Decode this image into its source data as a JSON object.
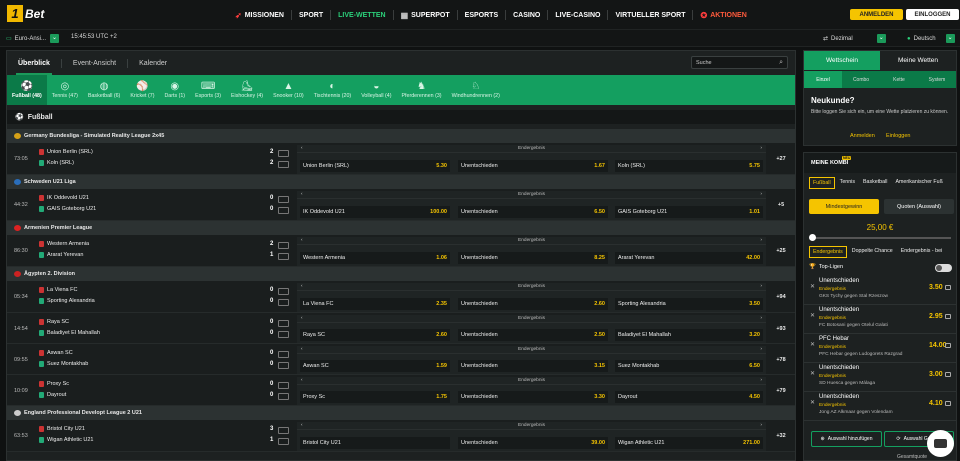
{
  "brand": {
    "one": "1",
    "bet": "Bet"
  },
  "nav": [
    {
      "label": "MISSIONEN",
      "icon": "rocket-icon",
      "style": "normal"
    },
    {
      "label": "SPORT",
      "style": "normal"
    },
    {
      "label": "LIVE-WETTEN",
      "style": "green"
    },
    {
      "label": "SUPERPOT",
      "icon": "grid-icon",
      "style": "normal"
    },
    {
      "label": "ESPORTS",
      "style": "normal"
    },
    {
      "label": "CASINO",
      "style": "normal"
    },
    {
      "label": "LIVE-CASINO",
      "style": "normal"
    },
    {
      "label": "VIRTUELLER SPORT",
      "style": "normal"
    },
    {
      "label": "AKTIONEN",
      "icon": "gift-icon",
      "style": "red"
    }
  ],
  "auth": {
    "register": "ANMELDEN",
    "login": "EINLOGGEN"
  },
  "subbar": {
    "odds_region": "Euro-Ansi...",
    "clock": "15:45:53 UTC +2",
    "odds_format": "Dezimal",
    "language": "Deutsch"
  },
  "tabs": [
    {
      "label": "Überblick"
    },
    {
      "label": "Event-Ansicht"
    },
    {
      "label": "Kalender"
    }
  ],
  "search": {
    "placeholder": "Suche"
  },
  "sports": [
    {
      "label": "Fußball (48)",
      "icon": "soccer-icon"
    },
    {
      "label": "Tennis (47)",
      "icon": "tennis-icon"
    },
    {
      "label": "Basketball (6)",
      "icon": "basketball-icon"
    },
    {
      "label": "Kricket (7)",
      "icon": "cricket-icon"
    },
    {
      "label": "Darts (1)",
      "icon": "darts-icon"
    },
    {
      "label": "Esports (3)",
      "icon": "gamepad-icon"
    },
    {
      "label": "Eishockey (4)",
      "icon": "hockey-icon"
    },
    {
      "label": "Snooker (10)",
      "icon": "snooker-icon"
    },
    {
      "label": "Tischtennis (20)",
      "icon": "table-tennis-icon"
    },
    {
      "label": "Volleyball (4)",
      "icon": "volleyball-icon"
    },
    {
      "label": "Pferderennen (3)",
      "icon": "horse-icon"
    },
    {
      "label": "Windhundrennen (2)",
      "icon": "greyhound-icon"
    }
  ],
  "section_title": "Fußball",
  "market_label": "Endergebnis",
  "draw_label": "Unentschieden",
  "leagues": [
    {
      "name": "Germany Bundesliga - Simulated Reality League 2x45",
      "flag": "#d4a017"
    },
    {
      "name": "Schweden U21 Liga",
      "flag": "#2a6ebb"
    },
    {
      "name": "Armenien Premier League",
      "flag": "#d22"
    },
    {
      "name": "Ägypten 2. Division",
      "flag": "#c22"
    },
    {
      "name": "England Professional Developt League 2 U21",
      "flag": "#ccc"
    }
  ],
  "matches": [
    {
      "time": "73:05",
      "home": "Union Berlin (SRL)",
      "away": "Koln (SRL)",
      "s1": "2",
      "s2": "2",
      "o1": "5.30",
      "ox": "1.67",
      "o2": "5.75",
      "more": "+27"
    },
    {
      "time": "44:32",
      "home": "IK Oddevold U21",
      "away": "GAIS Goteborg U21",
      "s1": "0",
      "s2": "0",
      "o1": "100.00",
      "ox": "6.50",
      "o2": "1.01",
      "more": "+5"
    },
    {
      "time": "86:30",
      "home": "Western Armenia",
      "away": "Ararat Yerevan",
      "s1": "2",
      "s2": "1",
      "o1": "1.06",
      "ox": "8.25",
      "o2": "42.00",
      "more": "+25"
    },
    {
      "time": "05:34",
      "home": "La Viena FC",
      "away": "Sporting Alexandria",
      "s1": "0",
      "s2": "0",
      "o1": "2.35",
      "ox": "2.60",
      "o2": "3.50",
      "more": "+94"
    },
    {
      "time": "14:54",
      "home": "Raya SC",
      "away": "Baladiyet El Mahallah",
      "s1": "0",
      "s2": "0",
      "o1": "2.60",
      "ox": "2.50",
      "o2": "3.20",
      "more": "+93"
    },
    {
      "time": "09:55",
      "home": "Aswan SC",
      "away": "Suez Montakhab",
      "s1": "0",
      "s2": "0",
      "o1": "1.59",
      "ox": "3.15",
      "o2": "6.50",
      "more": "+78"
    },
    {
      "time": "10:09",
      "home": "Proxy Sc",
      "away": "Dayrout",
      "s1": "0",
      "s2": "0",
      "o1": "1.75",
      "ox": "3.30",
      "o2": "4.50",
      "more": "+79"
    },
    {
      "time": "63:53",
      "home": "Bristol City U21",
      "away": "Wigan Athletic U21",
      "s1": "3",
      "s2": "1",
      "o1": "",
      "ox": "39.00",
      "o2": "271.00",
      "more": "+32"
    }
  ],
  "betslip": {
    "tab1": "Wettschein",
    "tab2": "Meine Wetten",
    "subtabs": [
      "Einzel",
      "Combo",
      "Kette",
      "System"
    ],
    "heading": "Neukunde?",
    "text": "Bitte loggen Sie sich ein, um eine Wette platzieren zu können.",
    "register": "Anmelden",
    "login": "Einloggen"
  },
  "kombi": {
    "title": "MEINE KOMBI",
    "badge": "NEU",
    "sports": [
      "Fußball",
      "Tennis",
      "Basketball",
      "Amerikanischer Fuß"
    ],
    "mode1": "Mindestgewinn",
    "mode2": "Quoten (Auswahl)",
    "amount": "25,00 €",
    "markets": [
      "Endergebnis",
      "Doppelte Chance",
      "Endergebnis - bei"
    ],
    "toplist": "Top-Ligen",
    "picks": [
      {
        "name": "Unentschieden",
        "type": "Endergebnis",
        "event": "GKS Tychy gegen Stal Rzeszow",
        "odd": "3.50"
      },
      {
        "name": "Unentschieden",
        "type": "Endergebnis",
        "event": "FC Botosani gegen Otelul Galati",
        "odd": "2.95"
      },
      {
        "name": "PFC Hebar",
        "type": "Endergebnis",
        "event": "PFC Hebar gegen Ludogorets Razgrad",
        "odd": "14.00"
      },
      {
        "name": "Unentschieden",
        "type": "Endergebnis",
        "event": "SD Huesca gegen Málaga",
        "odd": "3.00"
      },
      {
        "name": "Unentschieden",
        "type": "Endergebnis",
        "event": "Jong AZ Alkmaar gegen Volendam",
        "odd": "4.10"
      }
    ],
    "add": "Auswahl hinzufügen",
    "gen": "Auswahl Generie",
    "total": "Gesamtquote"
  }
}
